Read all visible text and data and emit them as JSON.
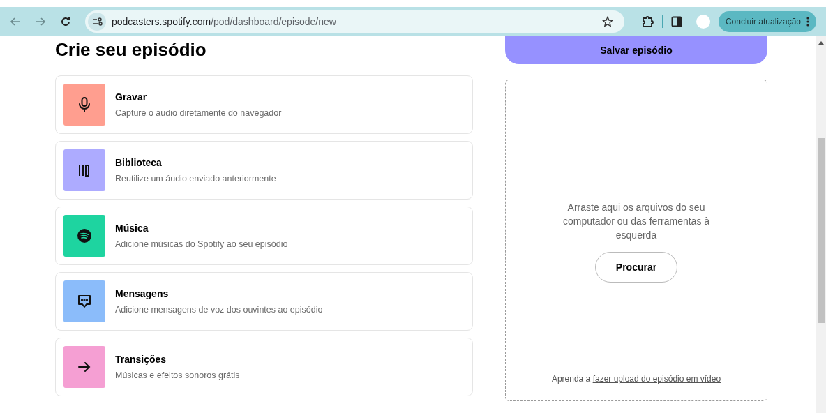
{
  "browser": {
    "url_host": "podcasters.spotify.com",
    "url_path": "/pod/dashboard/episode/new",
    "update_button": "Concluir atualização"
  },
  "page": {
    "title": "Crie seu episódio",
    "save_button": "Salvar episódio"
  },
  "tools": [
    {
      "kind": "mic",
      "title": "Gravar",
      "description": "Capture o áudio diretamente do navegador",
      "color": "#ff9e8f"
    },
    {
      "kind": "library",
      "title": "Biblioteca",
      "description": "Reutilize um áudio enviado anteriormente",
      "color": "#adabff"
    },
    {
      "kind": "music",
      "title": "Música",
      "description": "Adicione músicas do Spotify ao seu episódio",
      "color": "#1ed4a0"
    },
    {
      "kind": "message",
      "title": "Mensagens",
      "description": "Adicione mensagens de voz dos ouvintes ao episódio",
      "color": "#8bbcfa"
    },
    {
      "kind": "transition",
      "title": "Transições",
      "description": "Músicas e efeitos sonoros grátis",
      "color": "#f59fd3"
    }
  ],
  "dropzone": {
    "text": "Arraste aqui os arquivos do seu computador ou das ferramentas à esquerda",
    "browse_button": "Procurar",
    "help_prefix": "Aprenda a",
    "help_link": "fazer upload do episódio em vídeo"
  }
}
